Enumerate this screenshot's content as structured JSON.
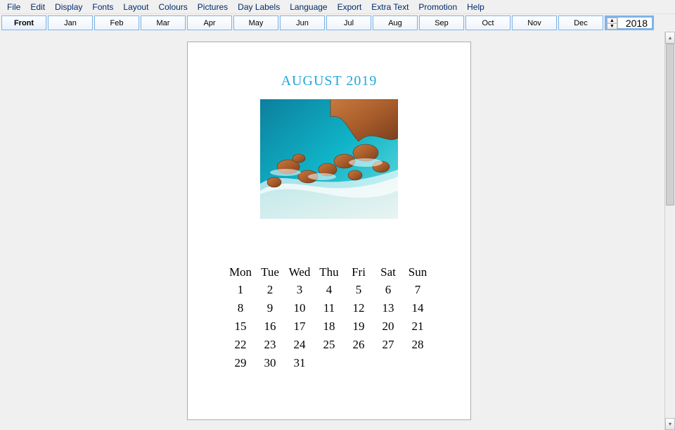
{
  "menu": {
    "items": [
      "File",
      "Edit",
      "Display",
      "Fonts",
      "Layout",
      "Colours",
      "Pictures",
      "Day Labels",
      "Language",
      "Export",
      "Extra Text",
      "Promotion",
      "Help"
    ]
  },
  "toolbar": {
    "months": [
      "Front",
      "Jan",
      "Feb",
      "Mar",
      "Apr",
      "May",
      "Jun",
      "Jul",
      "Aug",
      "Sep",
      "Oct",
      "Nov",
      "Dec"
    ],
    "year": "2018",
    "selected_month_label": "January"
  },
  "page": {
    "title": "AUGUST 2019",
    "day_headers": [
      "Mon",
      "Tue",
      "Wed",
      "Thu",
      "Fri",
      "Sat",
      "Sun"
    ],
    "weeks": [
      [
        "1",
        "2",
        "3",
        "4",
        "5",
        "6",
        "7"
      ],
      [
        "8",
        "9",
        "10",
        "11",
        "12",
        "13",
        "14"
      ],
      [
        "15",
        "16",
        "17",
        "18",
        "19",
        "20",
        "21"
      ],
      [
        "22",
        "23",
        "24",
        "25",
        "26",
        "27",
        "28"
      ],
      [
        "29",
        "30",
        "31",
        "",
        "",
        "",
        ""
      ]
    ],
    "picture_alt": "aerial-beach-rocks-photo"
  },
  "colors": {
    "accent_border": "#7eb4ea",
    "title": "#22a8d8",
    "menu_text": "#002a6b",
    "selected_month_bg": "#98befa",
    "shadow": "#b8b8b8"
  }
}
